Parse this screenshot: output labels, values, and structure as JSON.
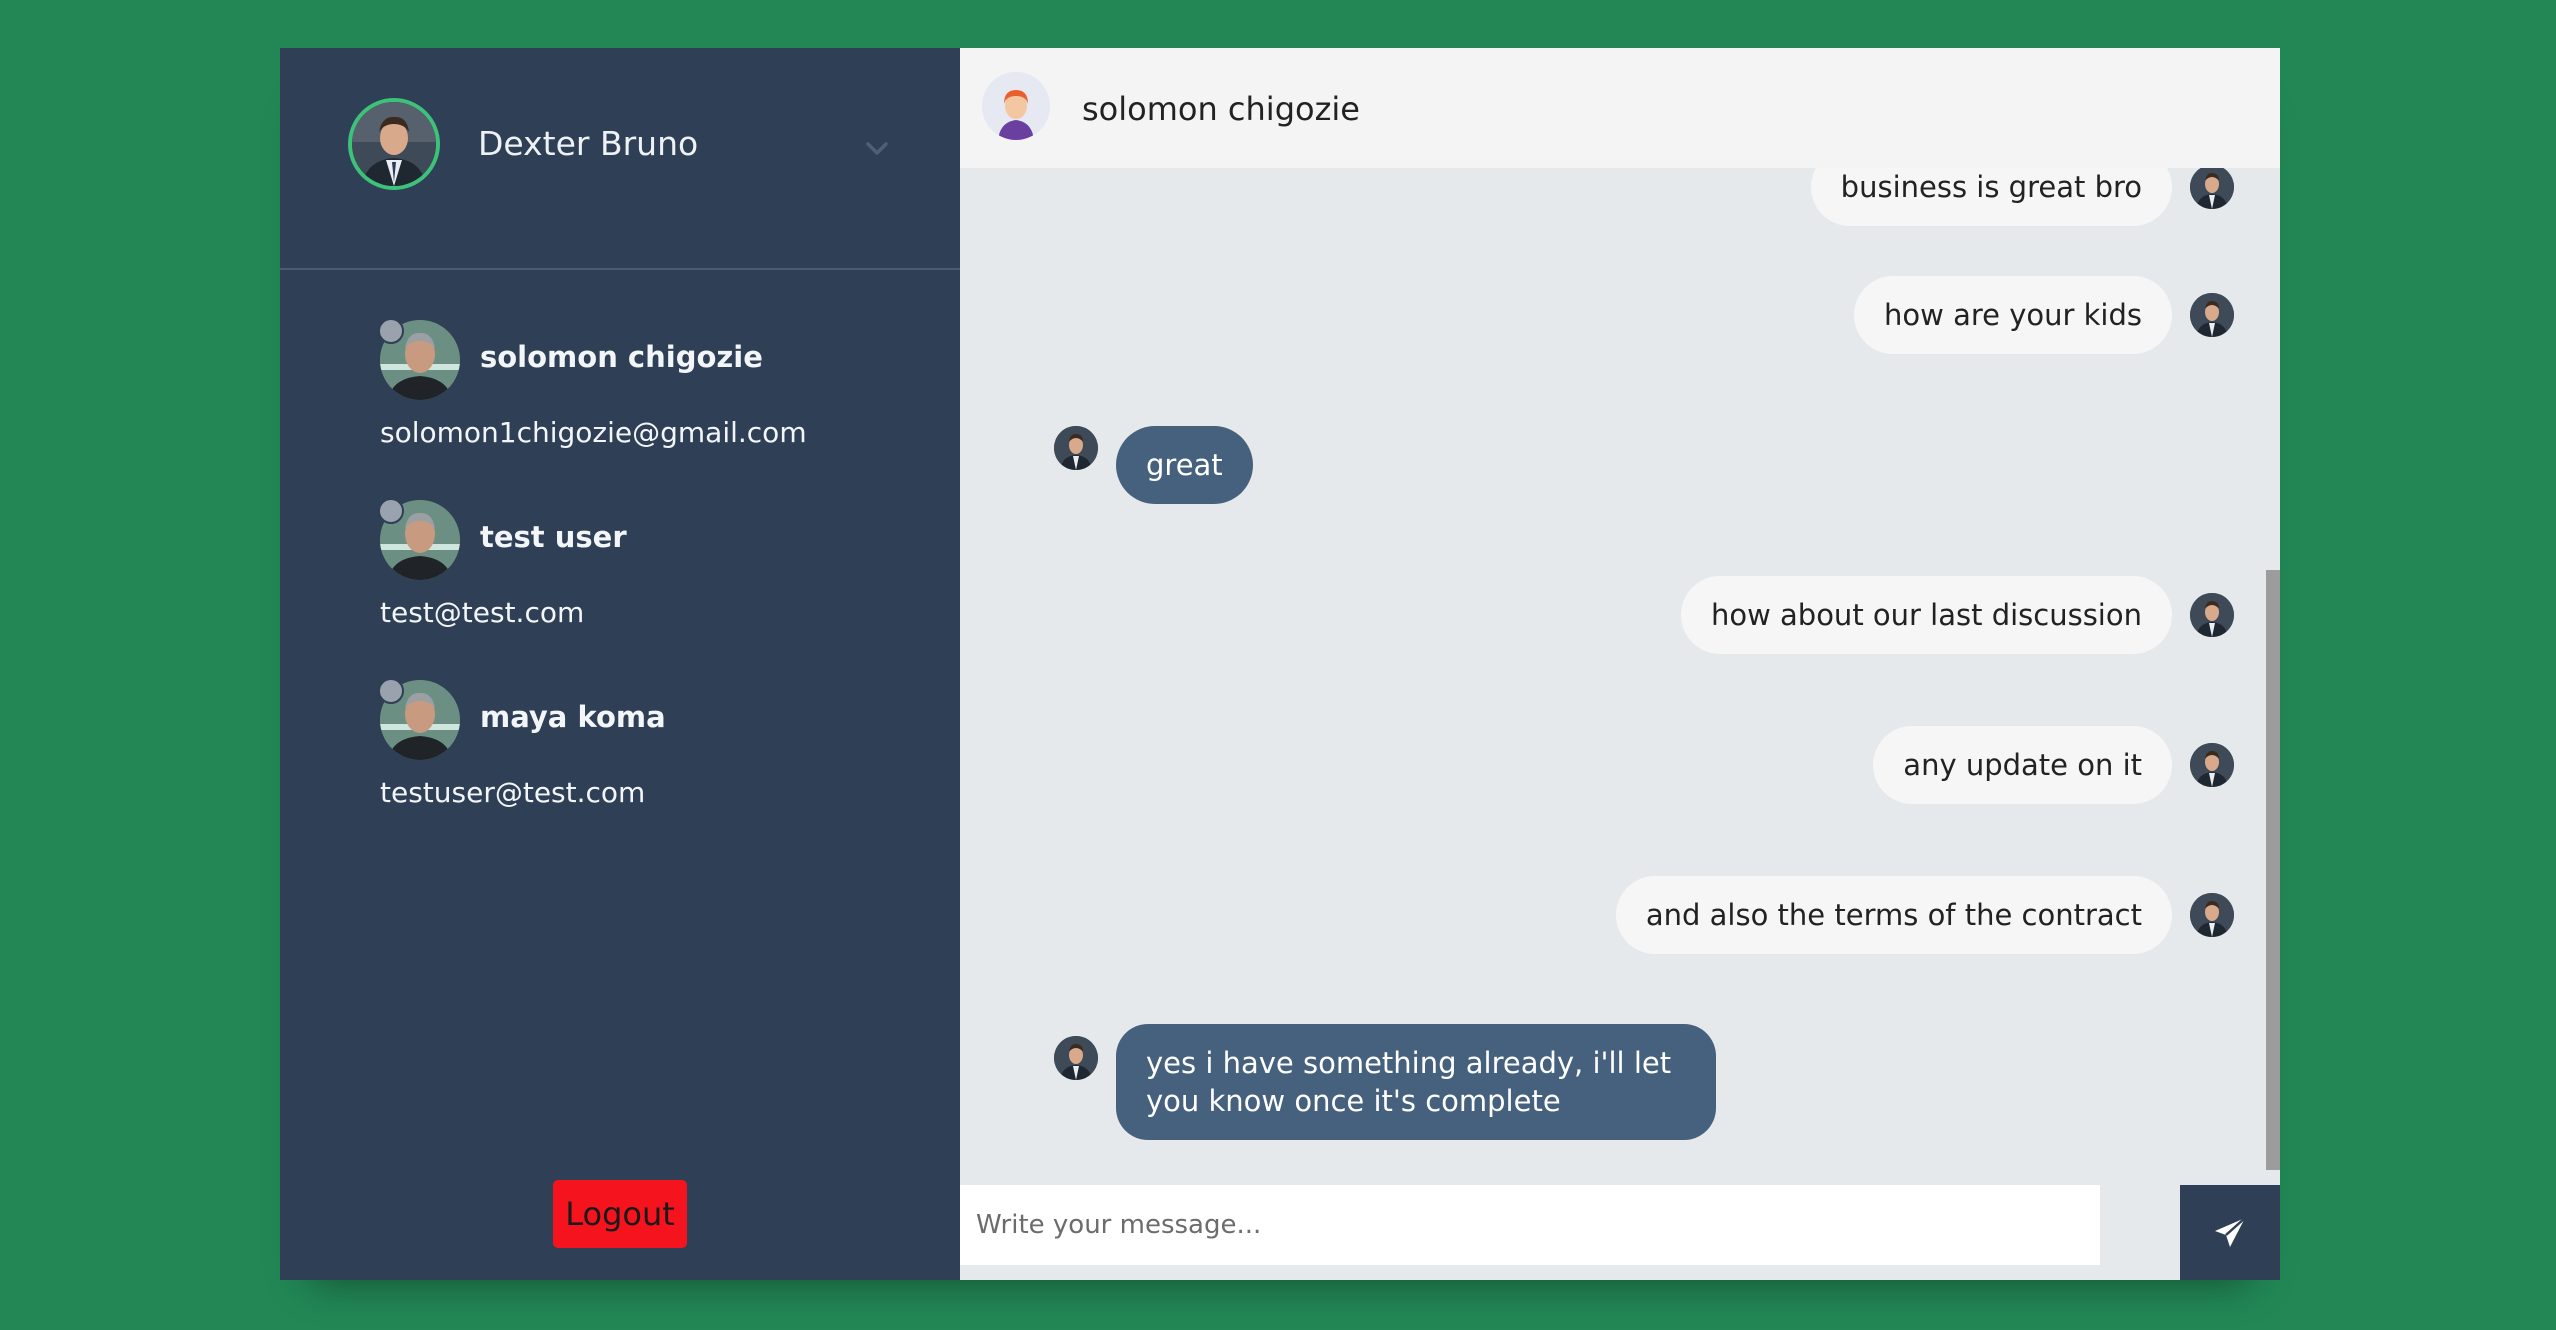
{
  "user": {
    "name": "Dexter Bruno"
  },
  "contacts": [
    {
      "name": "solomon chigozie",
      "email": "solomon1chigozie@gmail.com"
    },
    {
      "name": "test user",
      "email": "test@test.com"
    },
    {
      "name": "maya koma",
      "email": "testuser@test.com"
    }
  ],
  "logout_label": "Logout",
  "chat": {
    "partner_name": "solomon chigozie",
    "messages": [
      {
        "direction": "out",
        "text": "business is great bro"
      },
      {
        "direction": "out",
        "text": "how are your kids"
      },
      {
        "direction": "in",
        "text": "great"
      },
      {
        "direction": "out",
        "text": "how about our last discussion"
      },
      {
        "direction": "out",
        "text": "any update on it"
      },
      {
        "direction": "out",
        "text": "and also the terms of the contract"
      },
      {
        "direction": "in",
        "text": "yes i have something already, i'll let you know once it's complete"
      }
    ],
    "input_placeholder": "Write your message..."
  },
  "colors": {
    "page_bg": "#228755",
    "sidebar_bg": "#2f3f55",
    "chat_bg": "#e6e9eb",
    "incoming_bubble": "#45617e",
    "outgoing_bubble": "#f6f6f6",
    "logout_bg": "#f5141e",
    "online_ring": "#3dc27a"
  },
  "icons": {
    "dropdown": "chevron-down-icon",
    "send": "paper-plane-icon"
  }
}
